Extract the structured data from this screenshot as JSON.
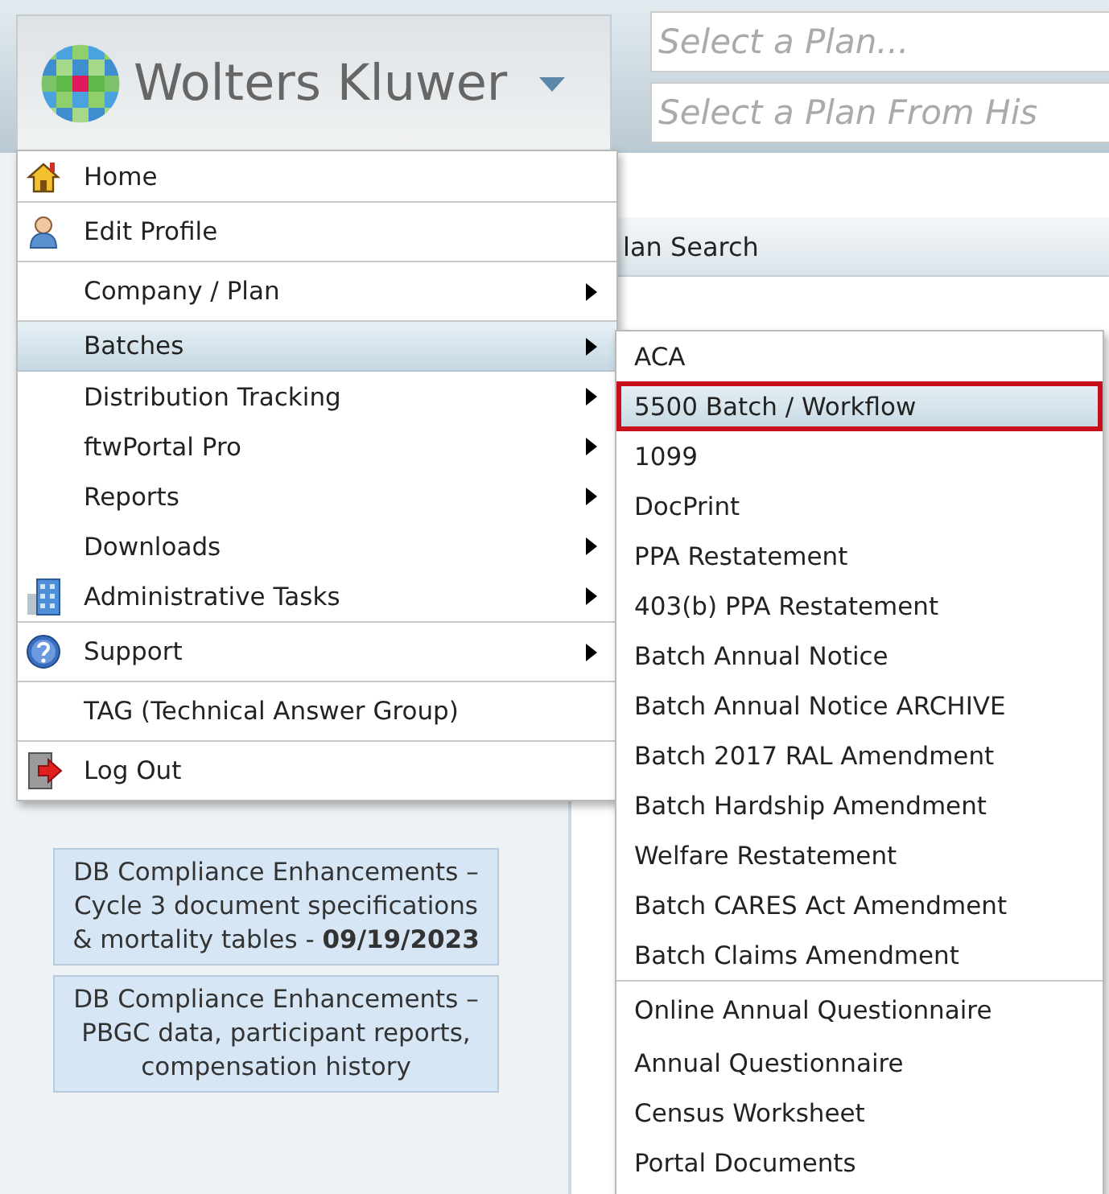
{
  "header": {
    "logo_text": "Wolters Kluwer",
    "plan_fields": [
      {
        "placeholder": "Select a Plan..."
      },
      {
        "placeholder": "Select a Plan From His"
      }
    ]
  },
  "page": {
    "tab_label": "lan Search",
    "news": [
      {
        "text": "DB Compliance Enhancements – Cycle 3 document specifications & mortality tables - **09/19/2023**"
      },
      {
        "text": "DB Compliance Enhancements – PBGC data, participant reports, compensation history"
      }
    ]
  },
  "menu": {
    "items": [
      {
        "label": "Home",
        "kind": "home",
        "has_submenu": false,
        "selected": false,
        "divider_before": false
      },
      {
        "label": "Edit Profile",
        "kind": "user",
        "has_submenu": false,
        "selected": false,
        "divider_before": true
      },
      {
        "label": "Company / Plan",
        "has_submenu": true,
        "selected": false,
        "divider_before": true
      },
      {
        "label": "Batches",
        "has_submenu": true,
        "selected": true,
        "divider_before": true
      },
      {
        "label": "Distribution Tracking",
        "has_submenu": true,
        "selected": false,
        "divider_before": false
      },
      {
        "label": "ftwPortal Pro",
        "has_submenu": true,
        "selected": false,
        "divider_before": false
      },
      {
        "label": "Reports",
        "has_submenu": true,
        "selected": false,
        "divider_before": false
      },
      {
        "label": "Downloads",
        "has_submenu": true,
        "selected": false,
        "divider_before": false
      },
      {
        "label": "Administrative Tasks",
        "kind": "building",
        "has_submenu": true,
        "selected": false,
        "divider_before": false
      },
      {
        "label": "Support",
        "kind": "help",
        "has_submenu": true,
        "selected": false,
        "divider_before": true
      },
      {
        "label": "TAG (Technical Answer Group)",
        "has_submenu": false,
        "selected": false,
        "divider_before": true
      },
      {
        "label": "Log Out",
        "kind": "logout",
        "has_submenu": false,
        "selected": false,
        "divider_before": true
      }
    ]
  },
  "submenu": {
    "items": [
      {
        "label": "ACA",
        "selected": false,
        "highlighted": false,
        "divider_before": false
      },
      {
        "label": "5500 Batch / Workflow",
        "selected": true,
        "highlighted": true,
        "divider_before": false
      },
      {
        "label": "1099",
        "selected": false,
        "highlighted": false,
        "divider_before": false
      },
      {
        "label": "DocPrint",
        "selected": false,
        "highlighted": false,
        "divider_before": false
      },
      {
        "label": "PPA Restatement",
        "selected": false,
        "highlighted": false,
        "divider_before": false
      },
      {
        "label": "403(b) PPA Restatement",
        "selected": false,
        "highlighted": false,
        "divider_before": false
      },
      {
        "label": "Batch Annual Notice",
        "selected": false,
        "highlighted": false,
        "divider_before": false
      },
      {
        "label": "Batch Annual Notice ARCHIVE",
        "selected": false,
        "highlighted": false,
        "divider_before": false
      },
      {
        "label": "Batch 2017 RAL Amendment",
        "selected": false,
        "highlighted": false,
        "divider_before": false
      },
      {
        "label": "Batch Hardship Amendment",
        "selected": false,
        "highlighted": false,
        "divider_before": false
      },
      {
        "label": "Welfare Restatement",
        "selected": false,
        "highlighted": false,
        "divider_before": false
      },
      {
        "label": "Batch CARES Act Amendment",
        "selected": false,
        "highlighted": false,
        "divider_before": false
      },
      {
        "label": "Batch Claims Amendment",
        "selected": false,
        "highlighted": false,
        "divider_before": false
      },
      {
        "label": "Online Annual Questionnaire",
        "selected": false,
        "highlighted": false,
        "divider_before": true
      },
      {
        "label": "Annual Questionnaire",
        "selected": false,
        "highlighted": false,
        "divider_before": false
      },
      {
        "label": "Census Worksheet",
        "selected": false,
        "highlighted": false,
        "divider_before": false
      },
      {
        "label": "Portal Documents",
        "selected": false,
        "highlighted": false,
        "divider_before": false
      }
    ]
  }
}
